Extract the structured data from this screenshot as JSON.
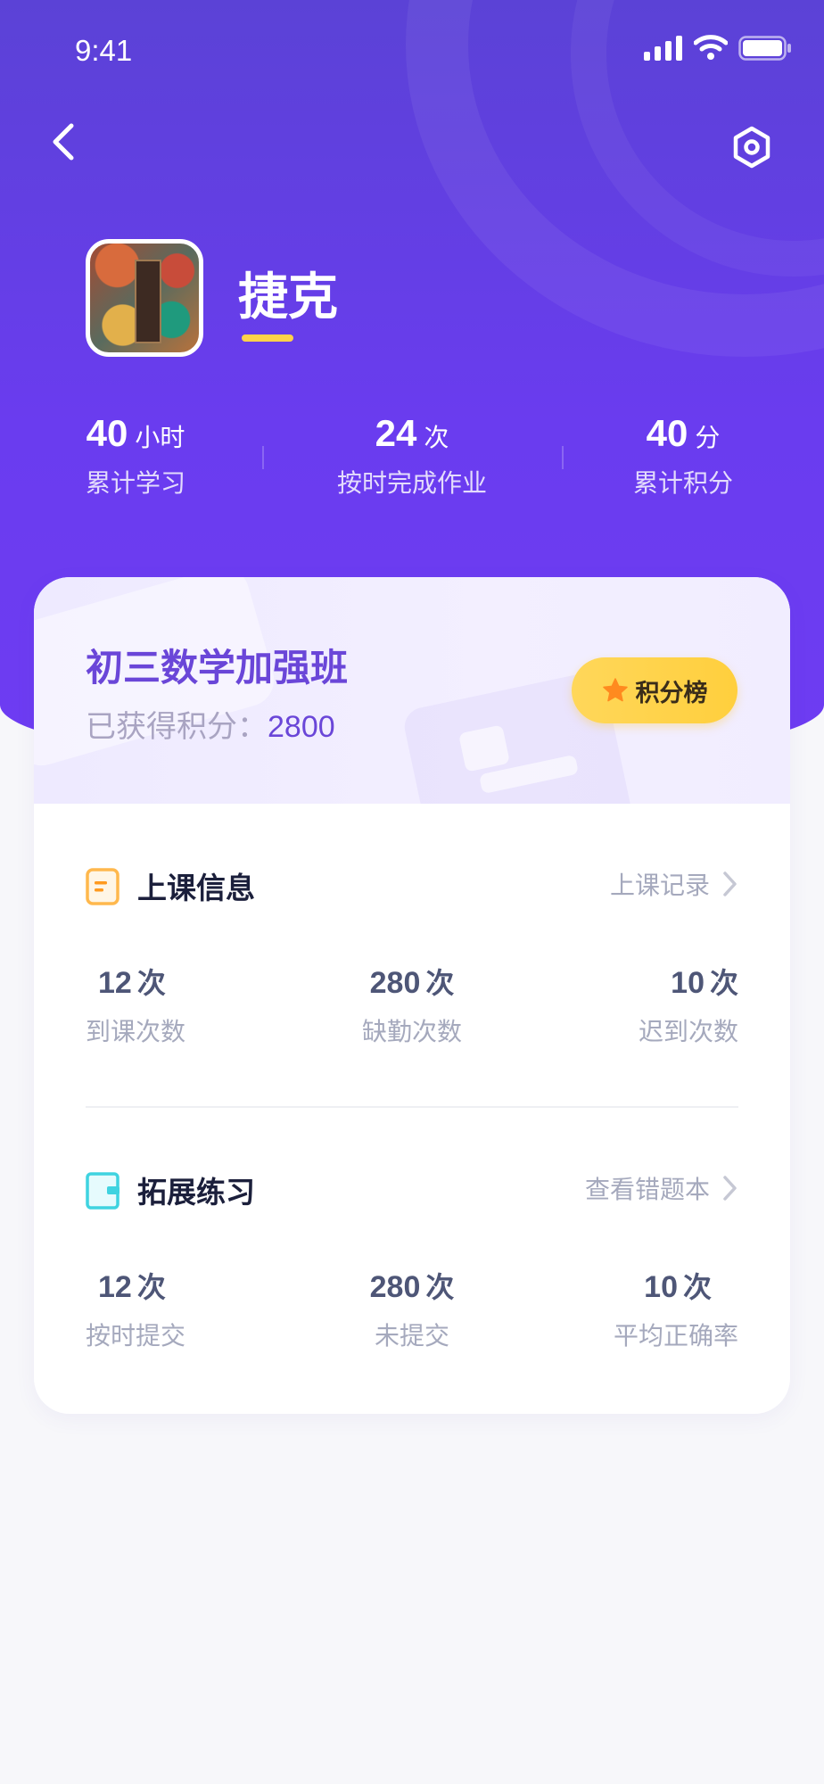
{
  "status_bar": {
    "time": "9:41"
  },
  "profile": {
    "name": "捷克"
  },
  "stats": [
    {
      "value": "40",
      "unit": "小时",
      "label": "累计学习"
    },
    {
      "value": "24",
      "unit": "次",
      "label": "按时完成作业"
    },
    {
      "value": "40",
      "unit": "分",
      "label": "累计积分"
    }
  ],
  "class_card": {
    "class_name": "初三数学加强班",
    "points_label": "已获得积分：",
    "points_value": "2800",
    "rank_button": "积分榜"
  },
  "attendance": {
    "title": "上课信息",
    "link": "上课记录",
    "metrics": [
      {
        "value": "12",
        "unit": "次",
        "label": "到课次数"
      },
      {
        "value": "280",
        "unit": "次",
        "label": "缺勤次数"
      },
      {
        "value": "10",
        "unit": "次",
        "label": "迟到次数"
      }
    ]
  },
  "practice": {
    "title": "拓展练习",
    "link": "查看错题本",
    "metrics": [
      {
        "value": "12",
        "unit": "次",
        "label": "按时提交"
      },
      {
        "value": "280",
        "unit": "次",
        "label": "未提交"
      },
      {
        "value": "10",
        "unit": "次",
        "label": "平均正确率"
      }
    ]
  },
  "colors": {
    "hero_top": "#5b42d6",
    "hero_bottom": "#6e3cf2",
    "accent_purple": "#6a46d8",
    "rank_yellow": "#ffd24a",
    "star_orange": "#ff8a1f",
    "attendance_icon": "#ffb84d",
    "practice_icon": "#3fd3e0"
  }
}
